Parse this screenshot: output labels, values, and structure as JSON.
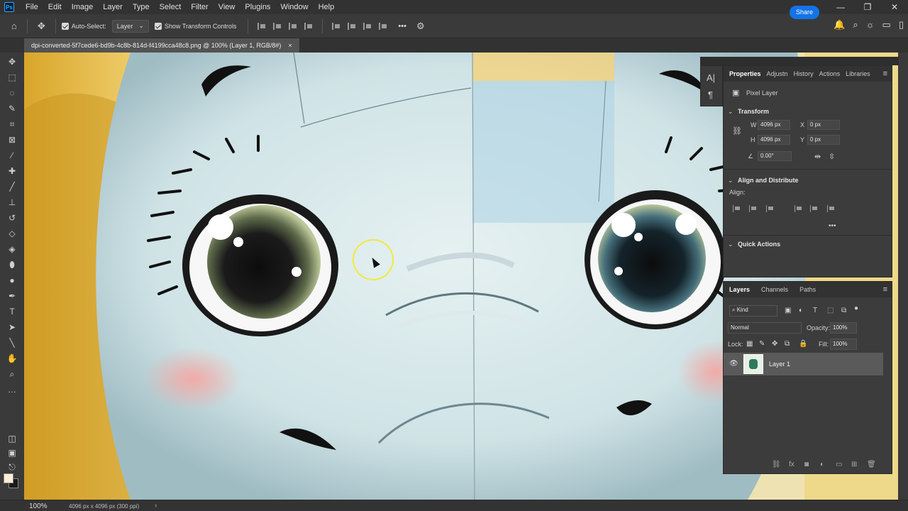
{
  "app": {
    "logo": "Ps"
  },
  "menu": [
    "File",
    "Edit",
    "Image",
    "Layer",
    "Type",
    "Select",
    "Filter",
    "View",
    "Plugins",
    "Window",
    "Help"
  ],
  "window_controls": {
    "minimize": "—",
    "maximize": "❐",
    "close": "✕"
  },
  "options_bar": {
    "auto_select_label": "Auto-Select:",
    "auto_select_value": "Layer",
    "show_transform_label": "Show Transform Controls",
    "more_label": "•••",
    "share_label": "Share"
  },
  "document_tab": {
    "title": "dpi-converted-5f7cede6-bd9b-4c8b-814d-f4199cca48c8.png @ 100% (Layer 1, RGB/8#)",
    "close": "×"
  },
  "properties_panel": {
    "tabs": [
      "Properties",
      "Adjustn",
      "History",
      "Actions",
      "Libraries"
    ],
    "layer_type": "Pixel Layer",
    "transform_title": "Transform",
    "w_label": "W",
    "w_value": "4096 px",
    "h_label": "H",
    "h_value": "4096 px",
    "x_label": "X",
    "x_value": "0 px",
    "y_label": "Y",
    "y_value": "0 px",
    "angle_value": "0.00°",
    "align_title": "Align and Distribute",
    "align_label": "Align:",
    "more": "•••",
    "quick_actions_title": "Quick Actions"
  },
  "layers_panel": {
    "tabs": [
      "Layers",
      "Channels",
      "Paths"
    ],
    "filter_kind": "Kind",
    "blend_mode": "Normal",
    "opacity_label": "Opacity:",
    "opacity_value": "100%",
    "lock_label": "Lock:",
    "fill_label": "Fill:",
    "fill_value": "100%",
    "layers": [
      {
        "name": "Layer 1",
        "visible": true
      }
    ]
  },
  "status": {
    "zoom": "100%",
    "doc_info": "4096 px x 4096 px (300 ppi)",
    "chevron": "›"
  },
  "colors": {
    "accent": "#1473e6",
    "foreground": "#fdf0d8",
    "background": "#1a1a1a"
  }
}
